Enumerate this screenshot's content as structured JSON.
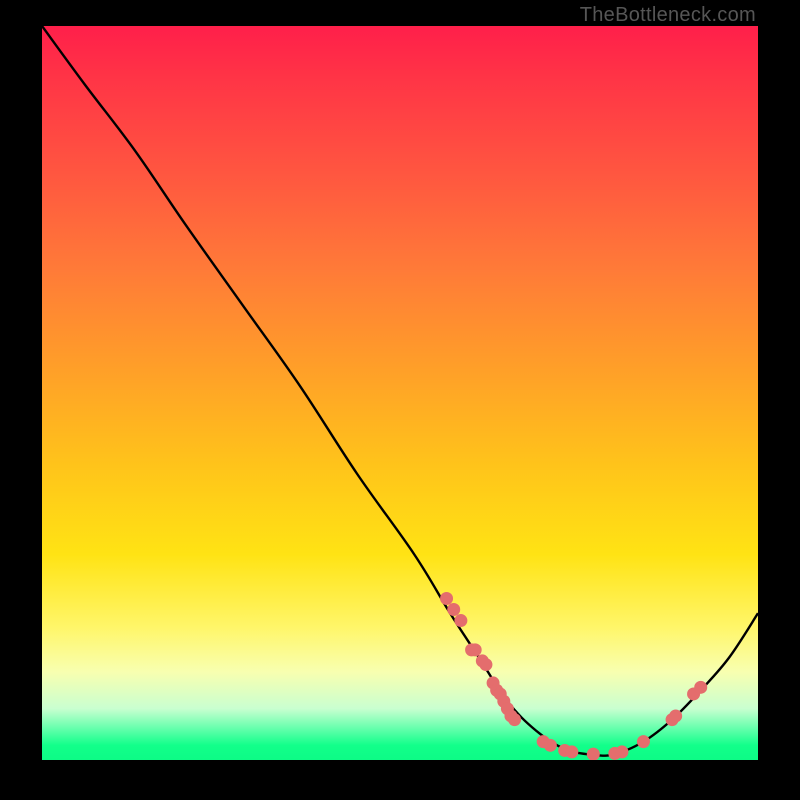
{
  "watermark": "TheBottleneck.com",
  "chart_data": {
    "type": "line",
    "title": "",
    "xlabel": "",
    "ylabel": "",
    "xlim": [
      0,
      100
    ],
    "ylim": [
      0,
      100
    ],
    "grid": false,
    "series": [
      {
        "name": "bottleneck-curve",
        "points": [
          [
            0,
            100
          ],
          [
            6,
            92
          ],
          [
            13,
            83
          ],
          [
            20,
            73
          ],
          [
            28,
            62
          ],
          [
            36,
            51
          ],
          [
            44,
            39
          ],
          [
            52,
            28
          ],
          [
            57,
            20
          ],
          [
            61,
            14
          ],
          [
            65,
            8
          ],
          [
            69,
            4
          ],
          [
            73,
            1.5
          ],
          [
            77,
            0.7
          ],
          [
            80,
            0.8
          ],
          [
            84,
            2.5
          ],
          [
            88,
            5.5
          ],
          [
            92,
            9.5
          ],
          [
            96,
            14
          ],
          [
            100,
            20
          ]
        ]
      }
    ],
    "highlight_points": [
      [
        56.5,
        22
      ],
      [
        57.5,
        20.5
      ],
      [
        58.5,
        19
      ],
      [
        60,
        15
      ],
      [
        60.5,
        15
      ],
      [
        61.5,
        13.5
      ],
      [
        62,
        13
      ],
      [
        63,
        10.5
      ],
      [
        63.5,
        9.5
      ],
      [
        64,
        9
      ],
      [
        64.5,
        8
      ],
      [
        65,
        7
      ],
      [
        65.5,
        6
      ],
      [
        66,
        5.5
      ],
      [
        70,
        2.5
      ],
      [
        71,
        2
      ],
      [
        73,
        1.3
      ],
      [
        74,
        1.1
      ],
      [
        77,
        0.8
      ],
      [
        80,
        0.9
      ],
      [
        81,
        1.1
      ],
      [
        84,
        2.5
      ],
      [
        88,
        5.5
      ],
      [
        88.5,
        6
      ],
      [
        91,
        9
      ],
      [
        92,
        9.9
      ]
    ],
    "colors": {
      "curve_stroke": "#000000",
      "highlight_fill": "#e46d6d"
    }
  }
}
